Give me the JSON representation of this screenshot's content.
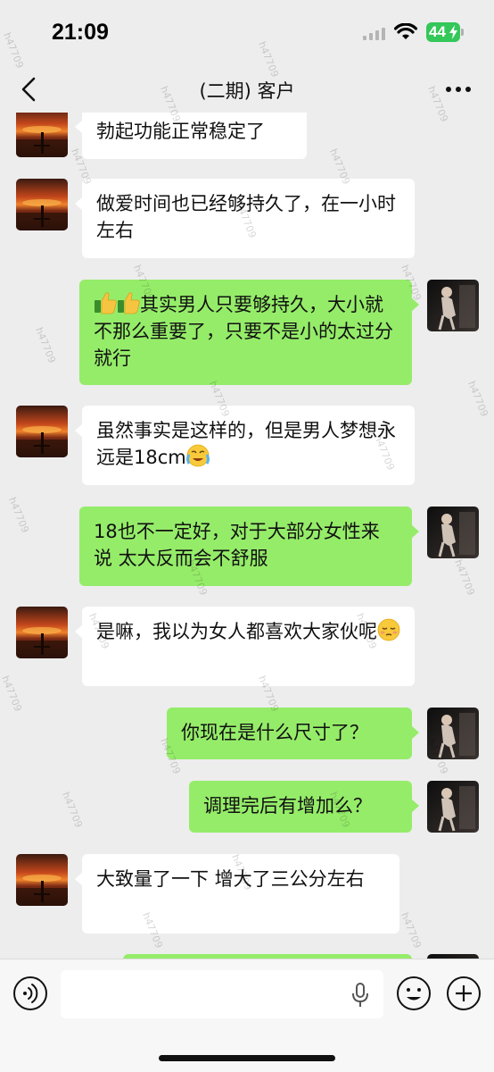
{
  "status_bar": {
    "time": "21:09",
    "battery": "44"
  },
  "header": {
    "title": "(二期) 客户"
  },
  "messages": [
    {
      "side": "in",
      "text": "勃起功能正常稳定了"
    },
    {
      "side": "in",
      "text": "做爱时间也已经够持久了，在一小时左右"
    },
    {
      "side": "out",
      "text": "其实男人只要够持久，大小就不那么重要了，只要不是小的太过分就行",
      "emoji_before": [
        "thumbs-up",
        "thumbs-up"
      ]
    },
    {
      "side": "in",
      "text": "虽然事实是这样的，但是男人梦想永远是18cm",
      "emoji_after": "crying-face"
    },
    {
      "side": "out",
      "text": "18也不一定好，对于大部分女性来说 太大反而会不舒服"
    },
    {
      "side": "in",
      "text": "是嘛，我以为女人都喜欢大家伙呢",
      "emoji_after": "relieved-face"
    },
    {
      "side": "out",
      "text": "你现在是什么尺寸了？"
    },
    {
      "side": "out",
      "text": "调理完后有增加么？"
    },
    {
      "side": "in",
      "text": "大致量了一下 增大了三公分左右"
    }
  ],
  "watermark_text": "h47709",
  "colors": {
    "background": "#ededed",
    "bubble_out": "#95ec69",
    "bubble_in": "#ffffff",
    "battery": "#34c759"
  },
  "icons": [
    "back-icon",
    "more-icon",
    "voice-icon",
    "microphone-icon",
    "emoji-icon",
    "plus-icon",
    "signal-icon",
    "wifi-icon"
  ]
}
